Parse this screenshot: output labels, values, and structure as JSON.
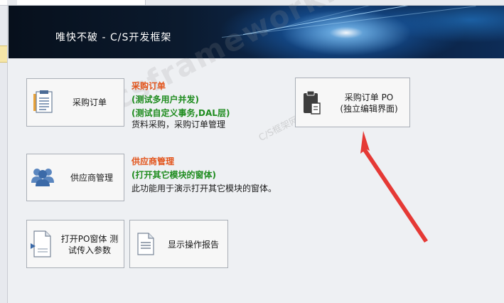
{
  "banner": {
    "title": "唯快不破 - C/S开发框架"
  },
  "buttons": {
    "po_order": "采购订单",
    "supplier": "供应商管理",
    "open_po_line1": "打开PO窗体 测",
    "open_po_line2": "试传入参数",
    "report": "显示操作报告",
    "po_standalone_line1": "采购订单 PO",
    "po_standalone_line2": "(独立编辑界面)"
  },
  "descriptions": {
    "po": {
      "title": "采购订单",
      "line1": "(测试多用户并发)",
      "line2": "(测试自定义事务,DAL层)",
      "line3": "货料采购，采购订单管理"
    },
    "supplier": {
      "title": "供应商管理",
      "line1": "(打开其它模块的窗体)",
      "line2": "此功能用于演示打开其它模块的窗体。"
    }
  },
  "watermark": {
    "main": "csframework.com",
    "sub": "C/S框架网"
  },
  "colors": {
    "title_orange": "#e2531a",
    "green": "#1f8c1f",
    "arrow_red": "#e53935",
    "banner_dark": "#0b1a2e"
  },
  "icons": [
    "clipboard-list-icon",
    "users-icon",
    "open-form-icon",
    "document-icon",
    "clipboard-dark-icon"
  ]
}
